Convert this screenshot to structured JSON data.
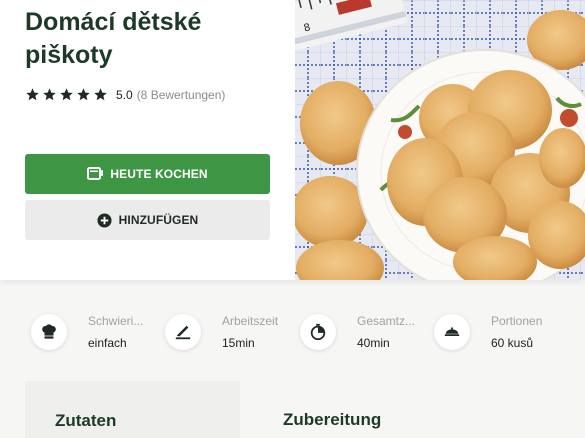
{
  "recipe": {
    "title": "Domácí dětské piškoty",
    "rating_value": "5.0",
    "rating_count": "(8 Bewertungen)",
    "stars": 5
  },
  "actions": {
    "cook_label": "HEUTE KOCHEN",
    "add_label": "HINZUFÜGEN"
  },
  "stats": [
    {
      "icon": "chef-hat-icon",
      "label": "Schwieri...",
      "value": "einfach"
    },
    {
      "icon": "knife-board-icon",
      "label": "Arbeitszeit",
      "value": "15min"
    },
    {
      "icon": "timer-icon",
      "label": "Gesamtz...",
      "value": "40min"
    },
    {
      "icon": "serving-dish-icon",
      "label": "Portionen",
      "value": "60 kusů"
    }
  ],
  "sections": {
    "ingredients_title": "Zutaten",
    "preparation_title": "Zubereitung"
  },
  "colors": {
    "primary_green": "#3e9645",
    "title_color": "#1d3a26",
    "secondary_button": "#ebebeb"
  }
}
